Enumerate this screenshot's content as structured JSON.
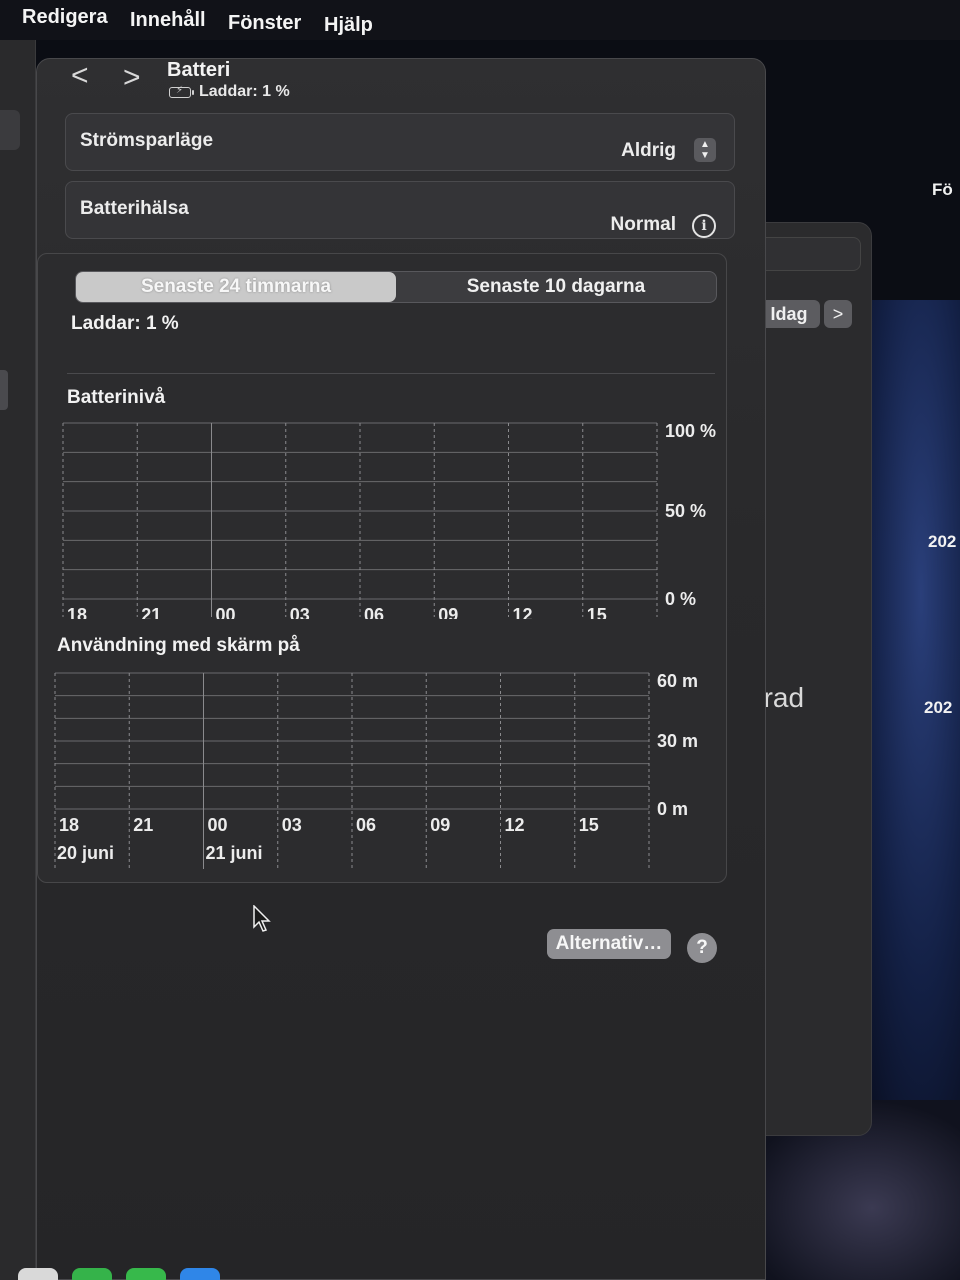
{
  "menubar": {
    "items": [
      "Redigera",
      "Innehåll",
      "Fönster",
      "Hjälp"
    ]
  },
  "background": {
    "wall_labels": [
      "Fö",
      "202",
      "202"
    ],
    "today_button": "Idag",
    "next_glyph": ">",
    "partial_text": "erad"
  },
  "window": {
    "title": "Batteri",
    "subtitle": "Laddar: 1 %",
    "nav_back": "<",
    "nav_forward": ">"
  },
  "settings": {
    "power_saving": {
      "label": "Strömsparläge",
      "value": "Aldrig"
    },
    "battery_health": {
      "label": "Batterihälsa",
      "value": "Normal"
    }
  },
  "tabs": [
    "Senaste 24 timmarna",
    "Senaste 10 dagarna"
  ],
  "active_tab": 0,
  "charge_status": "Laddar: 1 %",
  "charts": {
    "battery": {
      "title": "Batterinivå"
    },
    "usage": {
      "title": "Användning med skärm på"
    }
  },
  "chart_data": [
    {
      "type": "bar",
      "title": "Batterinivå",
      "categories": [
        "18",
        "21",
        "00",
        "03",
        "06",
        "09",
        "12",
        "15"
      ],
      "y_tick_labels": [
        "100 %",
        "50 %",
        "0 %"
      ],
      "ylim": [
        0,
        100
      ],
      "values": [],
      "grid": true
    },
    {
      "type": "bar",
      "title": "Användning med skärm på",
      "categories": [
        "18",
        "21",
        "00",
        "03",
        "06",
        "09",
        "12",
        "15"
      ],
      "date_labels": [
        {
          "label": "20 juni",
          "at": "18"
        },
        {
          "label": "21 juni",
          "at": "00"
        }
      ],
      "y_tick_labels": [
        "60 m",
        "30 m",
        "0 m"
      ],
      "ylim": [
        0,
        60
      ],
      "values": [],
      "grid": true
    }
  ],
  "buttons": {
    "options": "Alternativ…",
    "help": "?"
  },
  "icons": {
    "power_saving_stepper": "up-down-stepper-icon",
    "health_info": "info-circle-icon",
    "battery": "battery-charging-icon",
    "cursor": "mouse-pointer-icon"
  },
  "colors": {
    "window_bg": "#2f2f31",
    "active_segment": "#c9c9c9",
    "button_bg": "#8e8e92"
  }
}
